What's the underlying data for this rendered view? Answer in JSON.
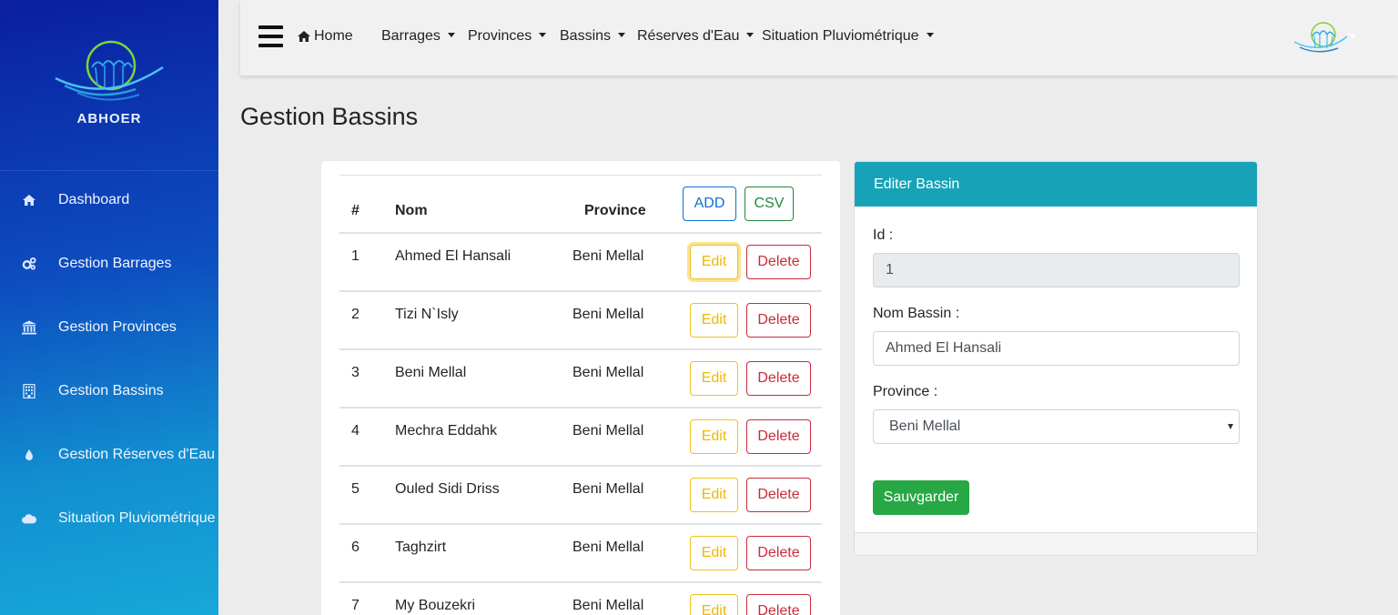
{
  "sidebar": {
    "brand_name": "ABHOER",
    "items": [
      {
        "label": "Dashboard",
        "icon": "home-icon"
      },
      {
        "label": "Gestion Barrages",
        "icon": "gears-icon"
      },
      {
        "label": "Gestion Provinces",
        "icon": "institution-icon"
      },
      {
        "label": "Gestion Bassins",
        "icon": "building-icon"
      },
      {
        "label": "Gestion Réserves d'Eau",
        "icon": "water-drop-icon"
      },
      {
        "label": "Situation Pluviométrique",
        "icon": "cloud-icon"
      }
    ]
  },
  "navbar": {
    "home": "Home",
    "menus": [
      "Barrages",
      "Provinces",
      "Bassins",
      "Réserves d'Eau",
      "Situation Pluviométrique"
    ]
  },
  "page": {
    "title": "Gestion Bassins"
  },
  "table": {
    "headers": {
      "num": "#",
      "nom": "Nom",
      "province": "Province"
    },
    "add_label": "ADD",
    "csv_label": "CSV",
    "edit_label": "Edit",
    "delete_label": "Delete",
    "rows": [
      {
        "num": "1",
        "nom": "Ahmed El Hansali",
        "province": "Beni Mellal"
      },
      {
        "num": "2",
        "nom": "Tizi N`Isly",
        "province": "Beni Mellal"
      },
      {
        "num": "3",
        "nom": "Beni Mellal",
        "province": "Beni Mellal"
      },
      {
        "num": "4",
        "nom": "Mechra Eddahk",
        "province": "Beni Mellal"
      },
      {
        "num": "5",
        "nom": "Ouled Sidi Driss",
        "province": "Beni Mellal"
      },
      {
        "num": "6",
        "nom": "Taghzirt",
        "province": "Beni Mellal"
      },
      {
        "num": "7",
        "nom": "My Bouzekri",
        "province": "Beni Mellal"
      }
    ]
  },
  "edit_form": {
    "header": "Editer Bassin",
    "id_label": "Id :",
    "id_value": "1",
    "nom_label": "Nom Bassin :",
    "nom_value": "Ahmed El Hansali",
    "province_label": "Province :",
    "province_value": "Beni Mellal",
    "save_label": "Sauvgarder"
  },
  "colors": {
    "sidebar_start": "#0a1fa0",
    "sidebar_end": "#16a8d8",
    "card_header": "#17a2b8",
    "save_button": "#28a745",
    "edit_button": "#f0b800",
    "delete_button": "#c92a3a"
  }
}
